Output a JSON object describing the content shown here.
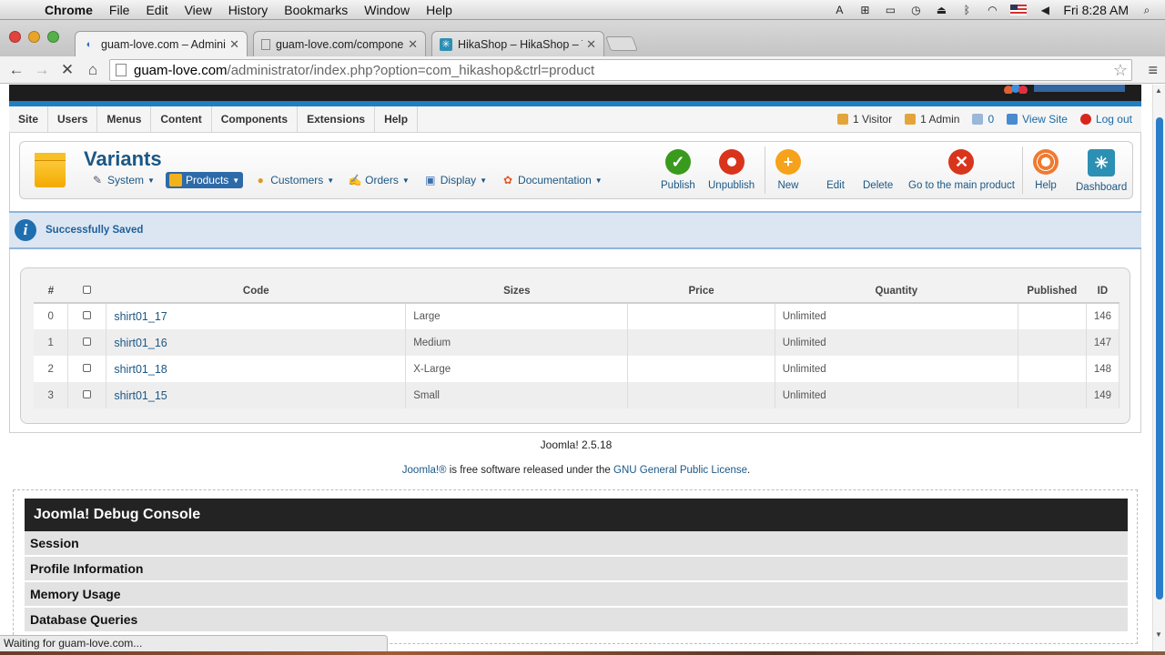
{
  "os_menubar": {
    "app": "Chrome",
    "items": [
      "File",
      "Edit",
      "View",
      "History",
      "Bookmarks",
      "Window",
      "Help"
    ],
    "clock": "Fri 8:28 AM"
  },
  "tabs": [
    {
      "title": "guam-love.com – Adminis",
      "active": true
    },
    {
      "title": "guam-love.com/compone",
      "active": false
    },
    {
      "title": "HikaShop – HikaShop – To",
      "active": false
    }
  ],
  "address": {
    "host": "guam-love.com",
    "path": "/administrator/index.php?option=com_hikashop&ctrl=product"
  },
  "joomla_menu": [
    "Site",
    "Users",
    "Menus",
    "Content",
    "Components",
    "Extensions",
    "Help"
  ],
  "status_items": {
    "visitors": "1 Visitor",
    "admins": "1 Admin",
    "messages": "0",
    "view_site": "View Site",
    "logout": "Log out"
  },
  "page_title": "Variants",
  "hika_menu": [
    {
      "label": "System",
      "icon": "wrench-icon"
    },
    {
      "label": "Products",
      "icon": "box-icon",
      "active": true
    },
    {
      "label": "Customers",
      "icon": "users-icon"
    },
    {
      "label": "Orders",
      "icon": "pen-icon"
    },
    {
      "label": "Display",
      "icon": "display-icon"
    },
    {
      "label": "Documentation",
      "icon": "lifebuoy-icon"
    }
  ],
  "toolbar": {
    "publish": "Publish",
    "unpublish": "Unpublish",
    "new": "New",
    "edit": "Edit",
    "delete": "Delete",
    "main_product": "Go to the main product",
    "help": "Help",
    "dashboard": "Dashboard"
  },
  "message": "Successfully Saved",
  "table": {
    "headers": [
      "#",
      "",
      "Code",
      "Sizes",
      "Price",
      "Quantity",
      "Published",
      "ID"
    ],
    "rows": [
      {
        "num": "0",
        "code": "shirt01_17",
        "size": "Large",
        "price": "",
        "qty": "Unlimited",
        "published": "",
        "id": "146"
      },
      {
        "num": "1",
        "code": "shirt01_16",
        "size": "Medium",
        "price": "",
        "qty": "Unlimited",
        "published": "",
        "id": "147"
      },
      {
        "num": "2",
        "code": "shirt01_18",
        "size": "X-Large",
        "price": "",
        "qty": "Unlimited",
        "published": "",
        "id": "148"
      },
      {
        "num": "3",
        "code": "shirt01_15",
        "size": "Small",
        "price": "",
        "qty": "Unlimited",
        "published": "",
        "id": "149"
      }
    ]
  },
  "footer": {
    "version": "Joomla! 2.5.18",
    "joomla_link": "Joomla!®",
    "middle": " is free software released under the ",
    "license_link": "GNU General Public License",
    "end": "."
  },
  "debug": {
    "title": "Joomla! Debug Console",
    "sections": [
      "Session",
      "Profile Information",
      "Memory Usage",
      "Database Queries"
    ]
  },
  "browser_status": "Waiting for guam-love.com...",
  "colors": {
    "joomla_blue": "#1b5785",
    "accent_blue": "#1f7fc2",
    "publish_green": "#3a9a1e",
    "unpublish_red": "#d9341c",
    "new_orange": "#f6a21a",
    "delete_red": "#d9341c"
  }
}
